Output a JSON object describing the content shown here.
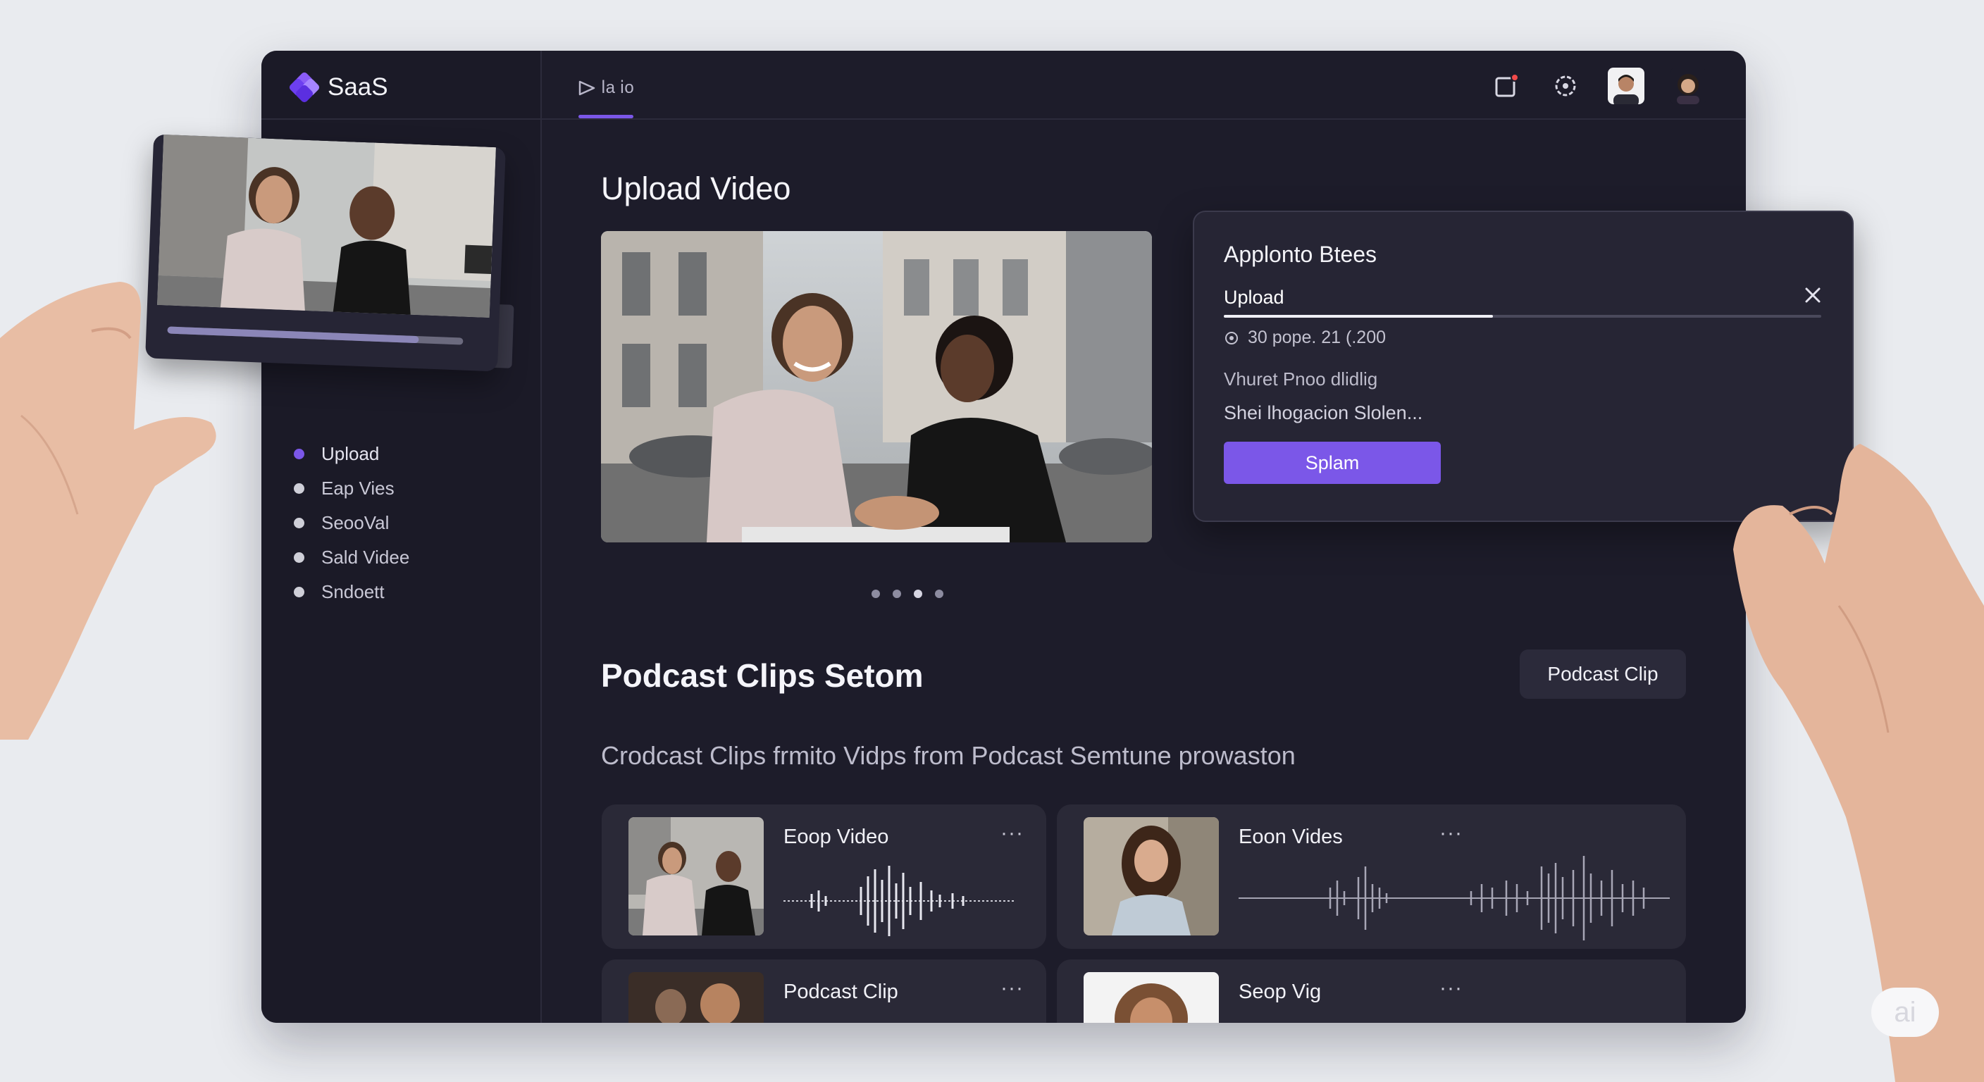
{
  "app": {
    "brand": "SaaS",
    "top_tab_label": "ⅼa ⅰo",
    "colors": {
      "accent": "#7b57e8",
      "background": "#1d1c2a",
      "panel": "#2a2937",
      "notification": "#f14a4a"
    }
  },
  "sidebar": {
    "items": [
      {
        "label": "Upload",
        "active": true
      },
      {
        "label": "Eap Vies",
        "active": false
      },
      {
        "label": "SeooVal",
        "active": false
      },
      {
        "label": "Sald Videe",
        "active": false
      },
      {
        "label": "Sndoett",
        "active": false
      }
    ]
  },
  "topbar": {
    "icons": [
      "notification-icon",
      "settings-icon"
    ],
    "avatars": [
      "user-avatar-1",
      "user-avatar-2"
    ]
  },
  "main": {
    "title": "Upload Video",
    "carousel": {
      "count": 4,
      "active_index": 2
    }
  },
  "clips_section": {
    "title": "Podcast Clips Setom",
    "button_label": "Podcast Clip",
    "subtitle": "Crodcast Clips frmito Vidps from Podcast Semtune prowaston",
    "cards": [
      {
        "title": "Eoop Video",
        "more": "···"
      },
      {
        "title": "Eoon Vides",
        "more": "···"
      },
      {
        "title": "Podcast Clip",
        "more": "···"
      },
      {
        "title": "Seop Vig",
        "more": "···"
      }
    ]
  },
  "dialog": {
    "title": "Applonto Btees",
    "tab_label": "Upload",
    "progress": 0.45,
    "meta_text": "30 pope. 21 (.200",
    "line1": "Vhuret Pnoo dlidlig",
    "line2": "Shei lhogacion Slolen...",
    "button_label": "Splam"
  },
  "photo_card": {
    "progress": 0.85
  },
  "watermark": "ai"
}
